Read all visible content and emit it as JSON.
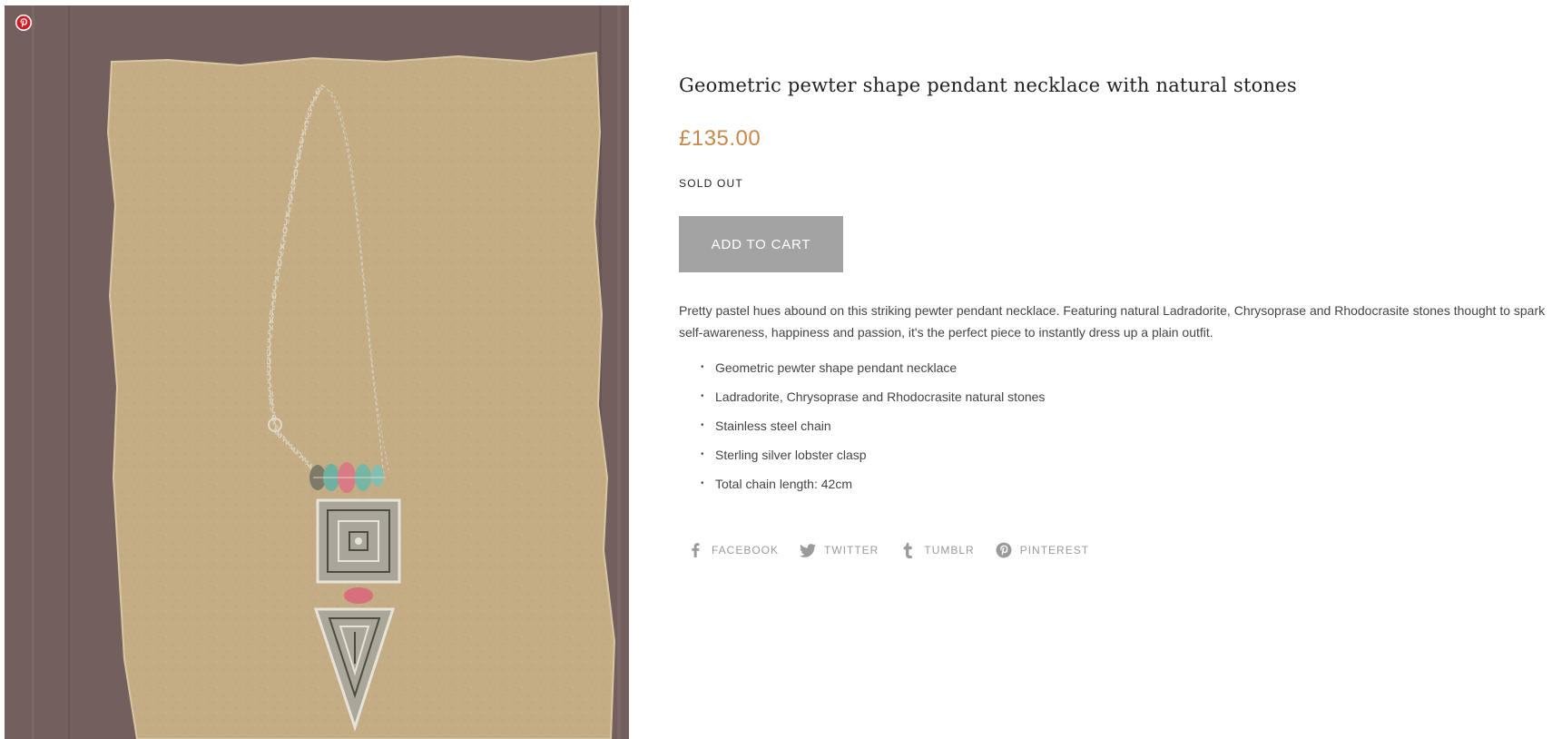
{
  "product": {
    "title": "Geometric pewter shape pendant necklace with natural stones",
    "price": "£135.00",
    "availability": "SOLD OUT",
    "add_to_cart_label": "ADD TO CART",
    "description": "Pretty pastel hues abound on this striking pewter pendant necklace. Featuring natural Ladradorite, Chrysoprase and Rhodocrasite stones thought to spark self-awareness, happiness and passion, it's the perfect piece to instantly dress up a plain outfit.",
    "features": [
      "Geometric pewter shape pendant necklace",
      "Ladradorite, Chrysoprase and Rhodocrasite natural stones",
      "Stainless steel chain",
      "Sterling silver lobster clasp",
      "Total chain length: 42cm"
    ]
  },
  "share": [
    {
      "label": "FACEBOOK",
      "icon": "facebook-icon"
    },
    {
      "label": "TWITTER",
      "icon": "twitter-icon"
    },
    {
      "label": "TUMBLR",
      "icon": "tumblr-icon"
    },
    {
      "label": "PINTEREST",
      "icon": "pinterest-icon"
    }
  ],
  "colors": {
    "price": "#c8874b",
    "button": "#a3a3a3",
    "share_text": "#9a9a9a",
    "pinterest_red": "#cb2027"
  }
}
